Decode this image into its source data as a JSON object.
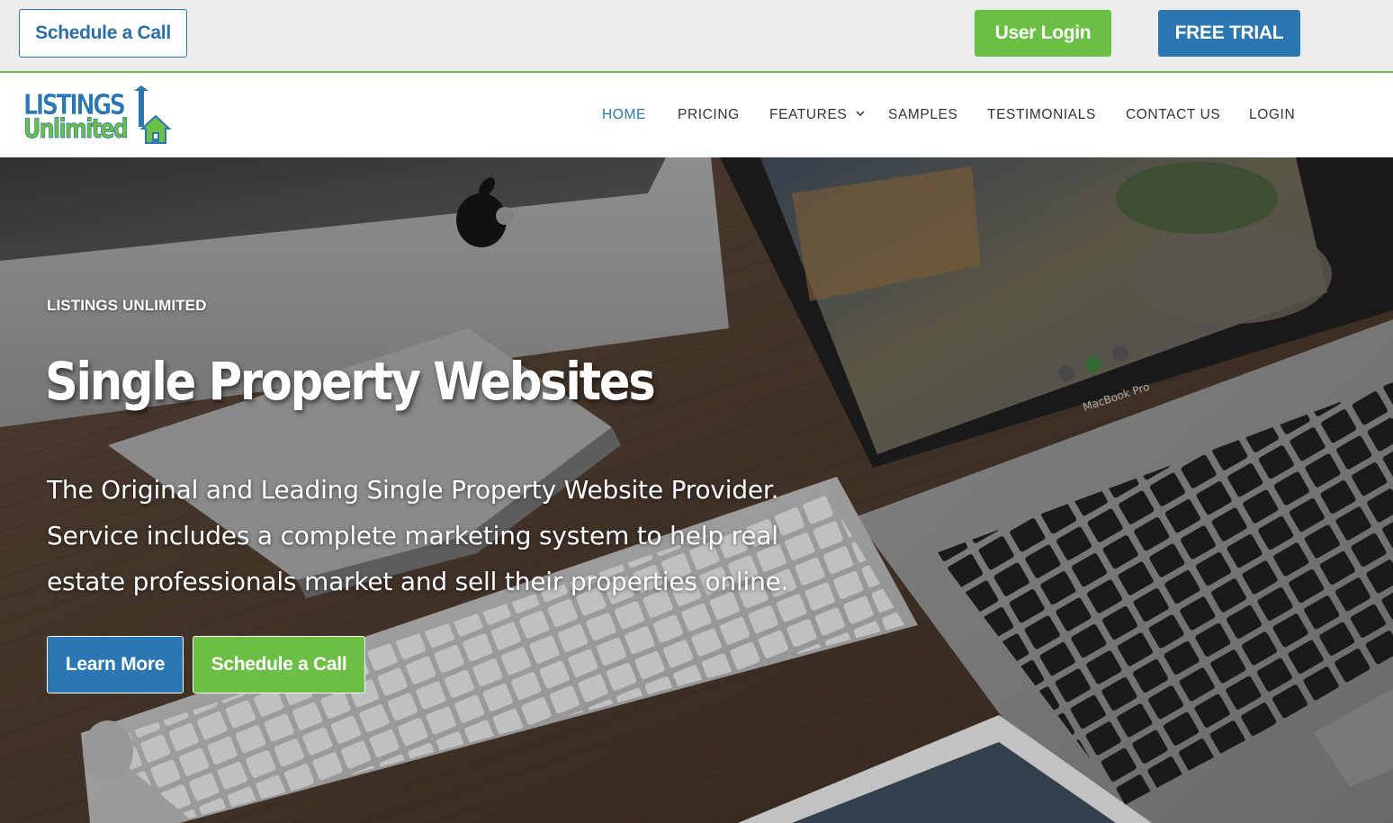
{
  "topbar": {
    "schedule_call_label": "Schedule a Call",
    "user_login_label": "User Login",
    "free_trial_label": "FREE TRIAL"
  },
  "brand": {
    "logo_line1": "LISTINGS",
    "logo_line2": "Unlimited",
    "blue": "#2a77b4",
    "green": "#6cbf45"
  },
  "nav": {
    "items": [
      {
        "label": "HOME",
        "active": true
      },
      {
        "label": "PRICING"
      },
      {
        "label": "FEATURES",
        "icon": "chevron-down-icon"
      },
      {
        "label": "SAMPLES"
      },
      {
        "label": "TESTIMONIALS"
      },
      {
        "label": "CONTACT US"
      },
      {
        "label": "LOGIN"
      }
    ]
  },
  "hero": {
    "eyebrow": "LISTINGS UNLIMITED",
    "title": "Single Property Websites",
    "copy_lines": [
      "The Original and Leading Single Property Website Provider.",
      "Service includes a complete marketing system to help real",
      "estate professionals market and sell their properties online."
    ],
    "learn_more_label": "Learn More",
    "schedule_call_label": "Schedule a Call",
    "laptop_label": "MacBook Pro"
  }
}
